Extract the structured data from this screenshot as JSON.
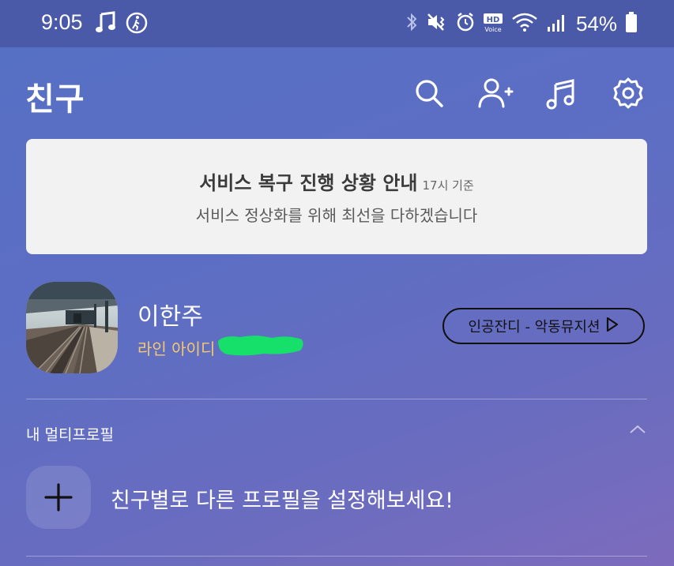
{
  "status_bar": {
    "time": "9:05",
    "battery": "54%",
    "icons_left": [
      "music-note-icon",
      "walking-icon"
    ],
    "icons_right": [
      "bluetooth-icon",
      "mute-vibrate-icon",
      "alarm-icon",
      "hd-voice-icon",
      "wifi-icon",
      "signal-icon",
      "battery-icon"
    ]
  },
  "header": {
    "title": "친구",
    "icons": [
      "search-icon",
      "add-friend-icon",
      "music-icon",
      "settings-icon"
    ]
  },
  "notice": {
    "title": "서비스 복구 진행 상황 안내",
    "subtitle": "17시 기준",
    "message": "서비스 정상화를 위해 최선을 다하겠습니다"
  },
  "profile": {
    "name": "이한주",
    "line_id_label": "라인 아이디",
    "music": "인공잔디 - 악동뮤지션"
  },
  "multi_profile": {
    "label": "내 멀티프로필",
    "add_text": "친구별로 다른 프로필을 설정해보세요!"
  },
  "colors": {
    "background": "#5a6ec3",
    "statusbar": "#4a5aa8",
    "notice_bg": "#f2f2f2",
    "line_id": "#f5c96c",
    "redaction": "#17e06a"
  }
}
